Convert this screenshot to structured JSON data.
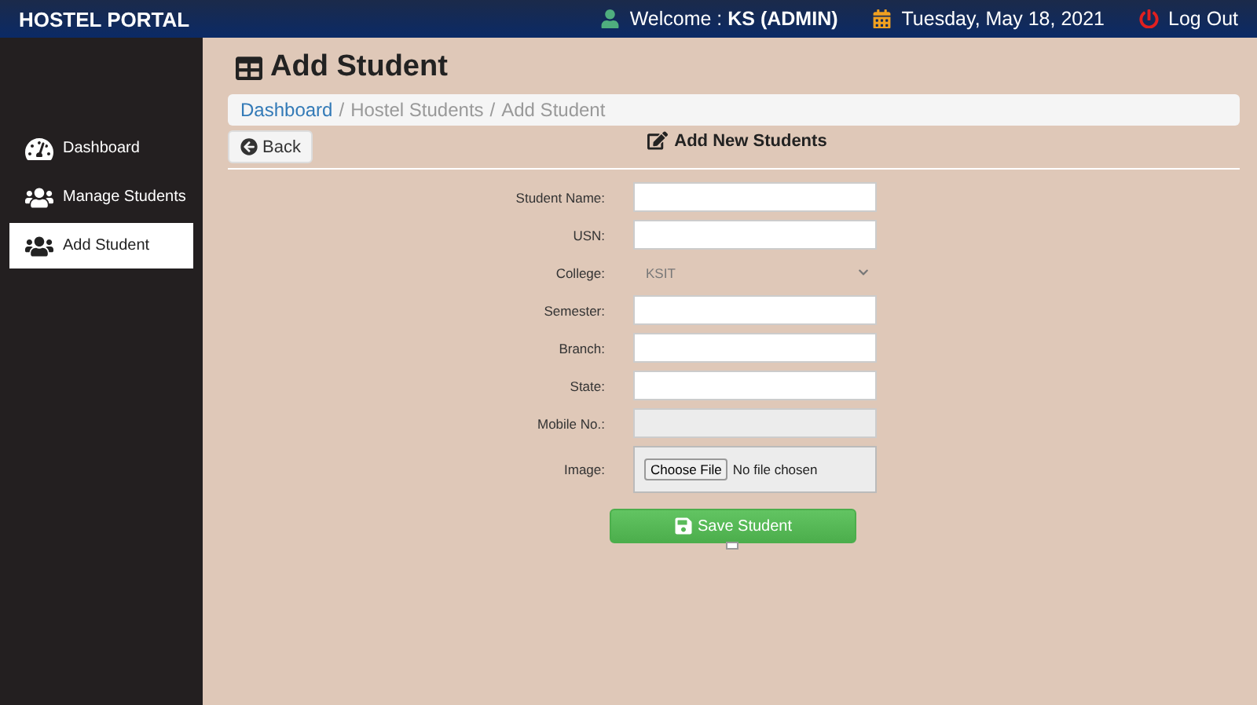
{
  "topbar": {
    "brand": "HOSTEL PORTAL",
    "welcome_label": "Welcome : ",
    "user": "KS (ADMIN)",
    "date": "Tuesday, May 18, 2021",
    "logout": "Log Out"
  },
  "sidebar": {
    "items": [
      {
        "label": "Dashboard",
        "kind": "gauge",
        "selected": false
      },
      {
        "label": "Manage Students",
        "kind": "users",
        "selected": false
      },
      {
        "label": "Add Student",
        "kind": "users",
        "selected": true
      }
    ]
  },
  "page": {
    "title": "Add Student",
    "breadcrumb_separator": "/",
    "breadcrumb": [
      {
        "label": "Dashboard",
        "link": true
      },
      {
        "label": "Hostel Students",
        "link": false
      },
      {
        "label": "Add Student",
        "link": false
      }
    ],
    "back": "Back",
    "form_title": "Add New Students"
  },
  "form": {
    "fields": [
      {
        "label": "Student Name:",
        "kind": "text"
      },
      {
        "label": "USN:",
        "kind": "text"
      },
      {
        "label": "College:",
        "kind": "select",
        "value": "KSIT"
      },
      {
        "label": "Semester:",
        "kind": "text"
      },
      {
        "label": "Branch:",
        "kind": "text"
      },
      {
        "label": "State:",
        "kind": "text"
      },
      {
        "label": "Mobile No.:",
        "kind": "text",
        "disabled": true
      },
      {
        "label": "Image:",
        "kind": "file",
        "button": "Choose File",
        "value": "No file chosen"
      }
    ],
    "submit": "Save Student",
    "checkbox": {
      "checked": false
    }
  }
}
